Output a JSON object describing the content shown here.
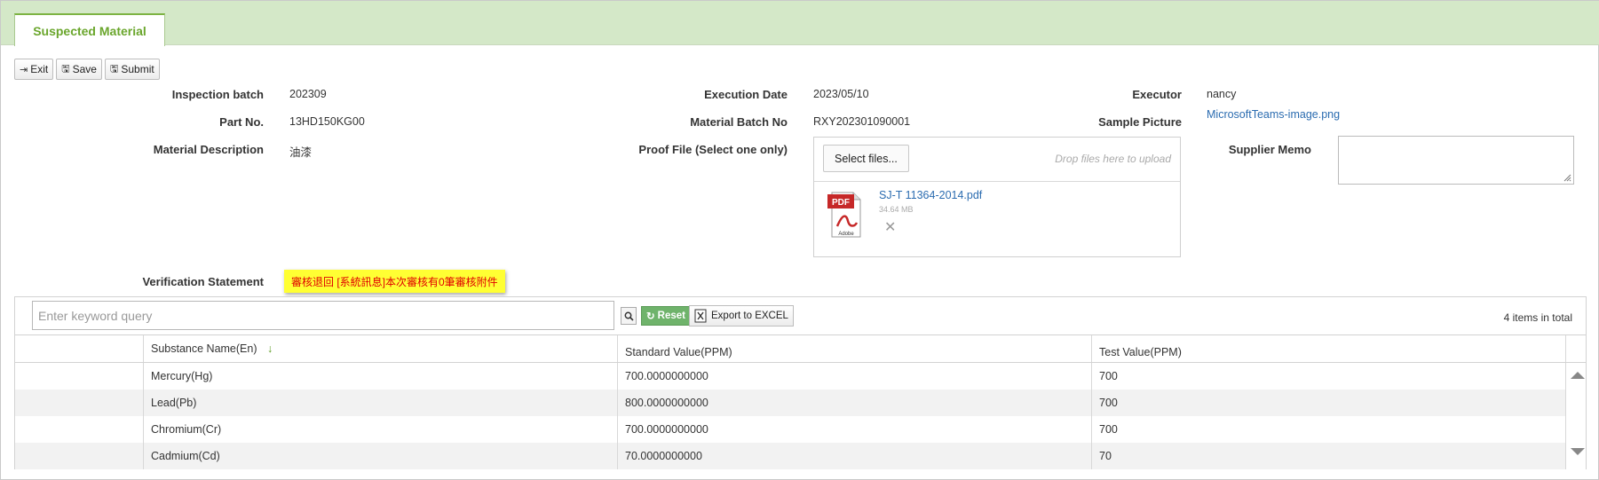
{
  "tab": {
    "label": "Suspected Material"
  },
  "toolbar": {
    "exit_label": "Exit",
    "save_label": "Save",
    "submit_label": "Submit"
  },
  "form": {
    "inspection_batch": {
      "label": "Inspection batch",
      "value": "202309"
    },
    "execution_date": {
      "label": "Execution Date",
      "value": "2023/05/10"
    },
    "executor": {
      "label": "Executor",
      "value": "nancy"
    },
    "part_no": {
      "label": "Part No.",
      "value": "13HD150KG00"
    },
    "material_batch_no": {
      "label": "Material Batch No",
      "value": "RXY202301090001"
    },
    "sample_picture": {
      "label": "Sample Picture",
      "value": "MicrosoftTeams-image.png"
    },
    "material_description": {
      "label": "Material Description",
      "value": "油漆"
    },
    "proof_file": {
      "label": "Proof File (Select one only)",
      "select_label": "Select files...",
      "drop_hint": "Drop files here to upload",
      "file": {
        "name": "SJ-T 11364-2014.pdf",
        "size": "34.64 MB",
        "icon": "pdf-icon",
        "icon_text_top": "PDF",
        "icon_text_bottom": "Adobe"
      }
    },
    "supplier_memo": {
      "label": "Supplier Memo",
      "value": ""
    },
    "verification_statement": {
      "label": "Verification Statement",
      "value": "審核退回 [系統訊息]本次審核有0筆審核附件"
    }
  },
  "grid": {
    "search_placeholder": "Enter keyword query",
    "reset_label": "Reset",
    "export_label": "Export to EXCEL",
    "total_text": "4 items in total",
    "columns": [
      "Substance Name(En)",
      "Standard Value(PPM)",
      "Test Value(PPM)"
    ],
    "rows": [
      {
        "name": "Mercury(Hg)",
        "standard": "700.0000000000",
        "test": "700"
      },
      {
        "name": "Lead(Pb)",
        "standard": "800.0000000000",
        "test": "700"
      },
      {
        "name": "Chromium(Cr)",
        "standard": "700.0000000000",
        "test": "700"
      },
      {
        "name": "Cadmium(Cd)",
        "standard": "70.0000000000",
        "test": "70"
      }
    ]
  },
  "colors": {
    "accent": "#7cb342",
    "tab_bar": "#d4e8c8",
    "link": "#2b6cb0",
    "reset": "#6fb36b",
    "badge_bg": "#ffff33",
    "badge_text": "#e00000"
  }
}
